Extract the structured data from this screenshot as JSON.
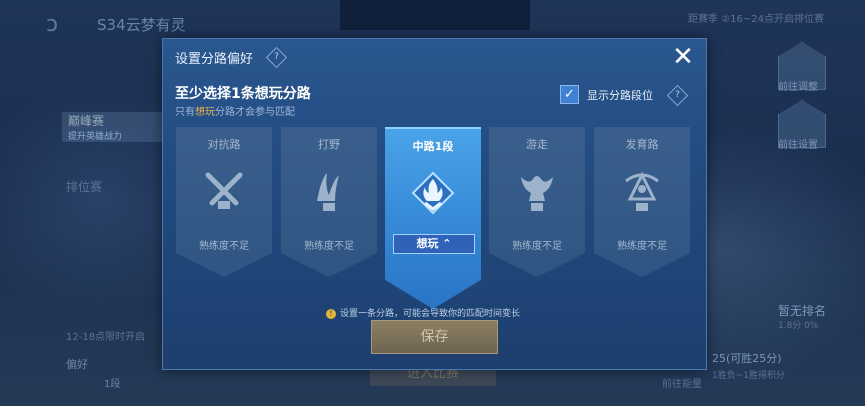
{
  "background": {
    "back_label": "ↄ",
    "season_title": "S34云梦有灵",
    "left_tab_active": "巅峰赛",
    "left_tab_sub": "提升英雄战力",
    "left_tab_rank": "排位赛",
    "left_time": "12-18点限时开启",
    "left_pref_label": "偏好",
    "left_pref_level": "1段",
    "right_notice": "距赛季 ②16~24点开启排位赛",
    "right_btn1": "前往调整",
    "right_btn2": "前往设置",
    "right_rank": "暂无排名",
    "right_rank_sub": "1.8分 0%",
    "bottom_score": "25(可胜25分)",
    "bottom_score_sub": "1胜负~1胜得积分",
    "bottom_left": "前往能量",
    "enter_button": "进入比赛"
  },
  "modal": {
    "title": "设置分路偏好",
    "heading": "至少选择1条想玩分路",
    "sub_prefix": "只有",
    "sub_highlight": "想玩",
    "sub_suffix": "分路才会参与匹配",
    "show_rank_label": "显示分路段位",
    "show_rank_checked": true,
    "lanes": [
      {
        "name": "对抗路",
        "status": "熟练度不足",
        "icon": "crossed-swords-icon"
      },
      {
        "name": "打野",
        "status": "熟练度不足",
        "icon": "claw-icon"
      },
      {
        "name": "中路1段",
        "status": "想玩",
        "icon": "flame-icon",
        "selected": true
      },
      {
        "name": "游走",
        "status": "熟练度不足",
        "icon": "dragon-icon"
      },
      {
        "name": "发育路",
        "status": "熟练度不足",
        "icon": "bow-icon"
      }
    ],
    "notice": "设置一条分路，可能会导致你的匹配时间变长",
    "save_label": "保存"
  },
  "colors": {
    "accent": "#e8b34d",
    "selected_lane": "#3485d4",
    "modal_bg": "#224b80"
  }
}
